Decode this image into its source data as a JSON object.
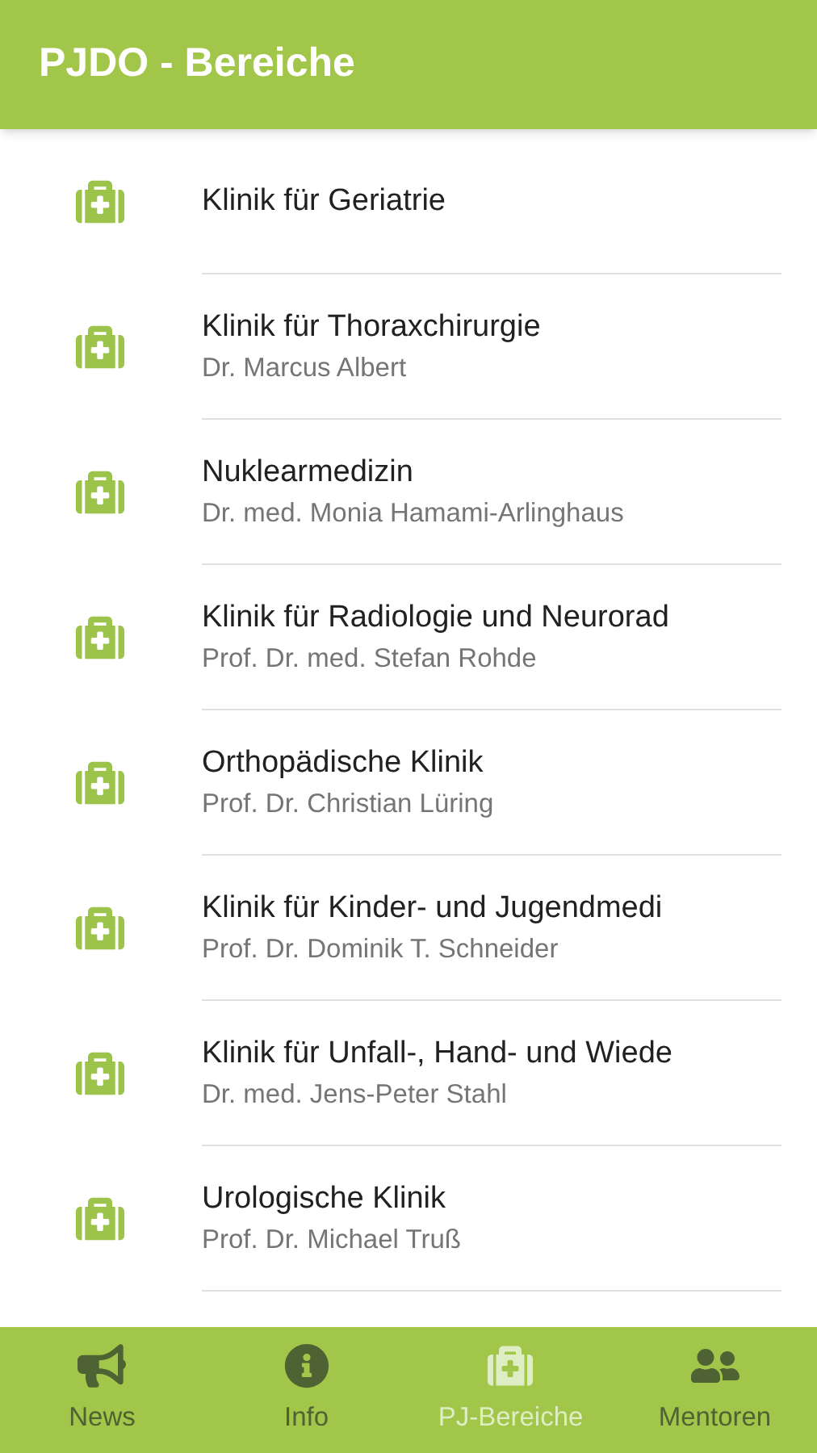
{
  "header": {
    "title": "PJDO - Bereiche"
  },
  "items": [
    {
      "title": "Klinik für Geriatrie"
    },
    {
      "title": "Klinik für Thoraxchirurgie",
      "subtitle": "Dr. Marcus Albert"
    },
    {
      "title": "Nuklearmedizin",
      "subtitle": "Dr. med. Monia Hamami-Arlinghaus"
    },
    {
      "title": "Klinik für Radiologie und Neurorad",
      "subtitle": "Prof. Dr. med. Stefan Rohde"
    },
    {
      "title": "Orthopädische Klinik",
      "subtitle": "Prof. Dr. Christian Lüring"
    },
    {
      "title": "Klinik für Kinder- und Jugendmedi",
      "subtitle": "Prof. Dr. Dominik T. Schneider"
    },
    {
      "title": "Klinik für Unfall-, Hand- und Wiede",
      "subtitle": "Dr. med. Jens-Peter Stahl"
    },
    {
      "title": "Urologische Klinik",
      "subtitle": "Prof. Dr. Michael Truß"
    }
  ],
  "nav": [
    {
      "label": "News",
      "kind": "news",
      "selected": false
    },
    {
      "label": "Info",
      "kind": "info",
      "selected": false
    },
    {
      "label": "PJ-Bereiche",
      "kind": "areas",
      "selected": true
    },
    {
      "label": "Mentoren",
      "kind": "mentors",
      "selected": false
    }
  ]
}
